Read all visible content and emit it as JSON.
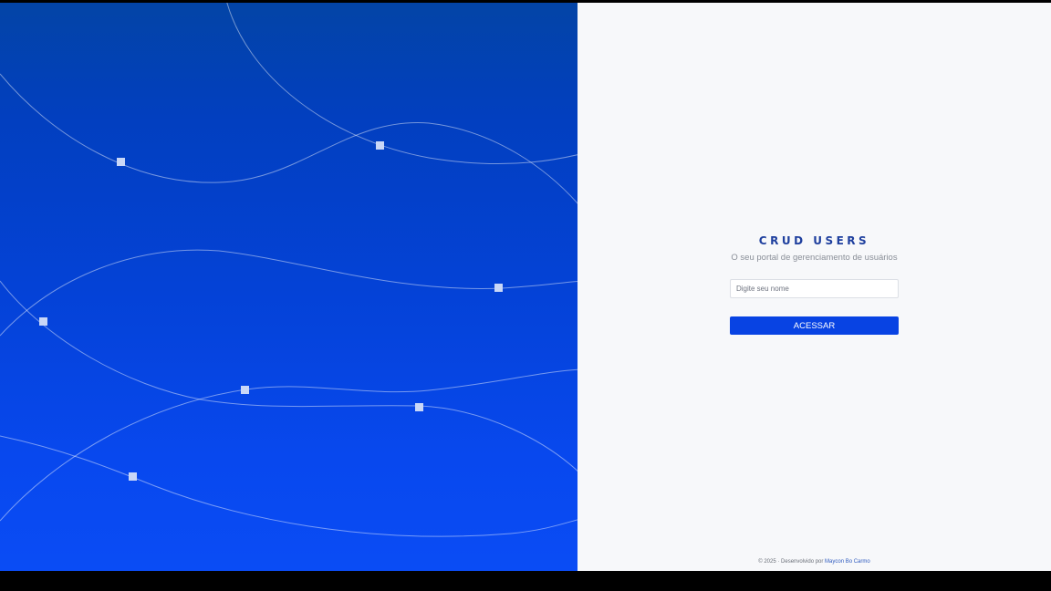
{
  "app": {
    "title": "CRUD USERS",
    "subtitle": "O seu portal de gerenciamento de usuários"
  },
  "login_form": {
    "name_placeholder": "Digite seu nome",
    "name_value": "",
    "submit_label": "ACESSAR"
  },
  "footer": {
    "prefix": "© 2025 · Desenvolvido por ",
    "author": "Maycon Bo Carmo"
  },
  "colors": {
    "brand_blue": "#0843e3",
    "title_blue": "#1e3f9e",
    "panel_gradient_top": "#0344a6",
    "panel_gradient_bottom": "#0a4cf5",
    "right_background": "#f7f8fa"
  },
  "decorations": {
    "left_panel_pattern": "wave-lines-with-nodes"
  }
}
